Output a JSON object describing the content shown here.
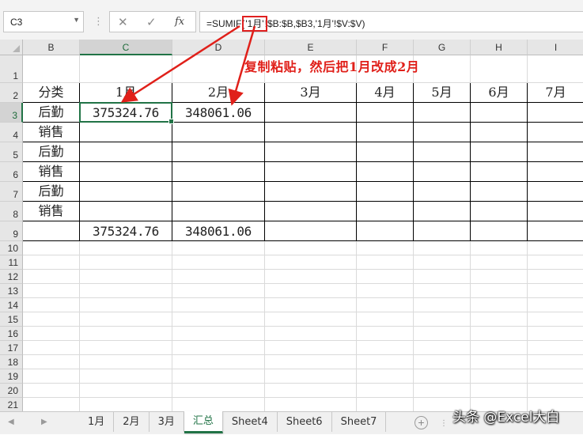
{
  "name_box": {
    "value": "C3",
    "dropdown": "▼"
  },
  "formula_bar": {
    "separator": "⋮",
    "cancel_icon": "✕",
    "enter_icon": "✓",
    "fx_label": "fx",
    "formula_prefix": "=SUMIF(",
    "formula_highlight": "'1月'",
    "formula_suffix": "!$B:$B,$B3,'1月'!$V:$V)"
  },
  "columns": [
    {
      "label": "B"
    },
    {
      "label": "C"
    },
    {
      "label": "D"
    },
    {
      "label": "E"
    },
    {
      "label": "F"
    },
    {
      "label": "G"
    },
    {
      "label": "H"
    },
    {
      "label": "I"
    }
  ],
  "selected_column": "C",
  "selected_row": "3",
  "rows": [
    "1",
    "2",
    "3",
    "4",
    "5",
    "6",
    "7",
    "8",
    "9",
    "10",
    "11",
    "12",
    "13",
    "14",
    "15",
    "16",
    "17",
    "18",
    "19",
    "20",
    "21"
  ],
  "table": {
    "header": [
      "分类",
      "1月",
      "2月",
      "3月",
      "4月",
      "5月",
      "6月",
      "7月"
    ],
    "body": [
      [
        "后勤",
        "375324.76",
        "348061.06",
        "",
        "",
        "",
        "",
        ""
      ],
      [
        "销售",
        "",
        "",
        "",
        "",
        "",
        "",
        ""
      ],
      [
        "后勤",
        "",
        "",
        "",
        "",
        "",
        "",
        ""
      ],
      [
        "销售",
        "",
        "",
        "",
        "",
        "",
        "",
        ""
      ],
      [
        "后勤",
        "",
        "",
        "",
        "",
        "",
        "",
        ""
      ],
      [
        "销售",
        "",
        "",
        "",
        "",
        "",
        "",
        ""
      ],
      [
        "",
        "375324.76",
        "348061.06",
        "",
        "",
        "",
        "",
        ""
      ]
    ]
  },
  "annotation": "复制粘贴，然后把1月改成2月",
  "annotation_color": "#e0201a",
  "accent_color": "#217346",
  "sheet_nav": {
    "prev_icon": "◀",
    "next_icon": "▶",
    "add_icon": "+",
    "scroll_icon": "⋮"
  },
  "sheet_tabs": [
    {
      "label": "1月",
      "active": false
    },
    {
      "label": "2月",
      "active": false
    },
    {
      "label": "3月",
      "active": false
    },
    {
      "label": "汇总",
      "active": true
    },
    {
      "label": "Sheet4",
      "active": false
    },
    {
      "label": "Sheet6",
      "active": false
    },
    {
      "label": "Sheet7",
      "active": false
    }
  ],
  "watermark": "头条 @Excel大白"
}
